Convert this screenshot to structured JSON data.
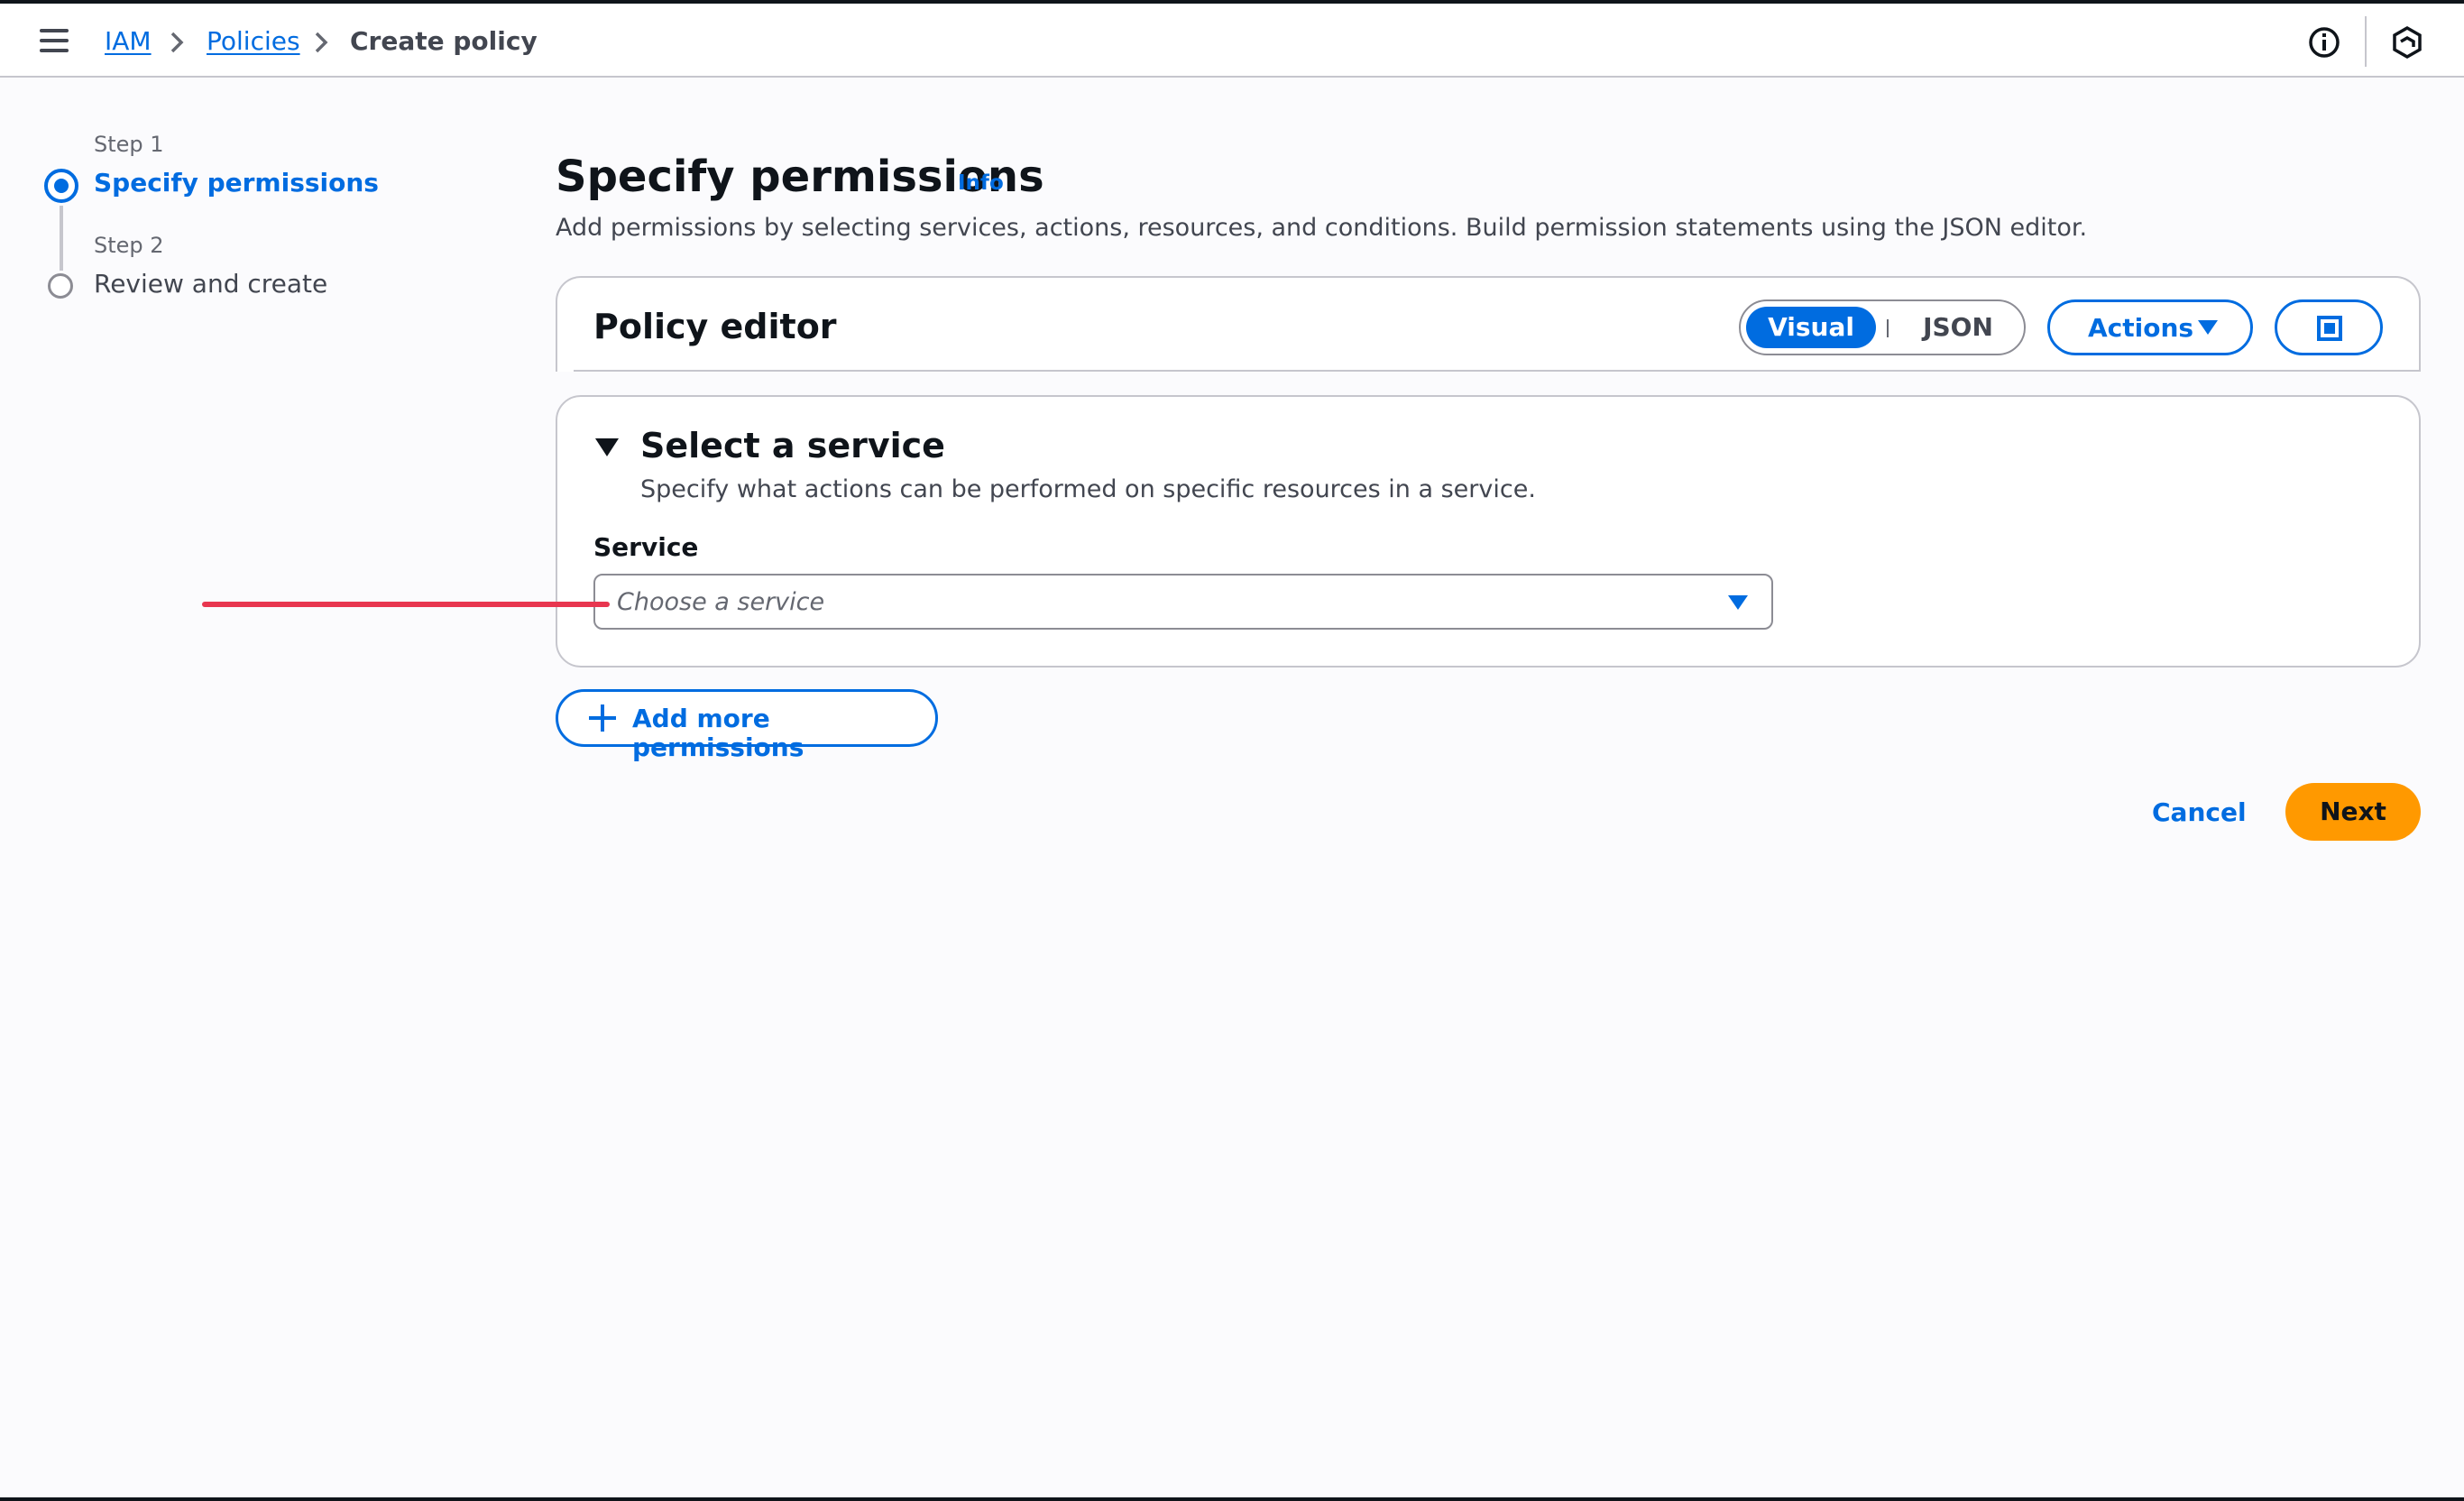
{
  "header": {
    "menu_icon": "hamburger-menu-icon",
    "breadcrumbs": [
      {
        "label": "IAM",
        "link": true
      },
      {
        "label": "Policies",
        "link": true
      },
      {
        "label": "Create policy",
        "link": false
      }
    ],
    "icons": [
      "info-circle-icon",
      "settings-hex-icon"
    ]
  },
  "steps": [
    {
      "step_label": "Step 1",
      "title": "Specify permissions",
      "active": true
    },
    {
      "step_label": "Step 2",
      "title": "Review and create",
      "active": false
    }
  ],
  "main": {
    "title": "Specify permissions",
    "info_label": "Info",
    "description": "Add permissions by selecting services, actions, resources, and conditions. Build permission statements using the JSON editor."
  },
  "editor": {
    "title": "Policy editor",
    "mode_visual": "Visual",
    "mode_json": "JSON",
    "selected_mode": "Visual",
    "actions_label": "Actions"
  },
  "service_section": {
    "title": "Select a service",
    "description": "Specify what actions can be performed on specific resources in a service.",
    "field_label": "Service",
    "placeholder": "Choose a service"
  },
  "footer": {
    "add_label": "Add more permissions",
    "cancel_label": "Cancel",
    "next_label": "Next"
  },
  "colors": {
    "accent": "#006ce0",
    "primary_button": "#ff9900",
    "annotation": "#e8364f"
  }
}
